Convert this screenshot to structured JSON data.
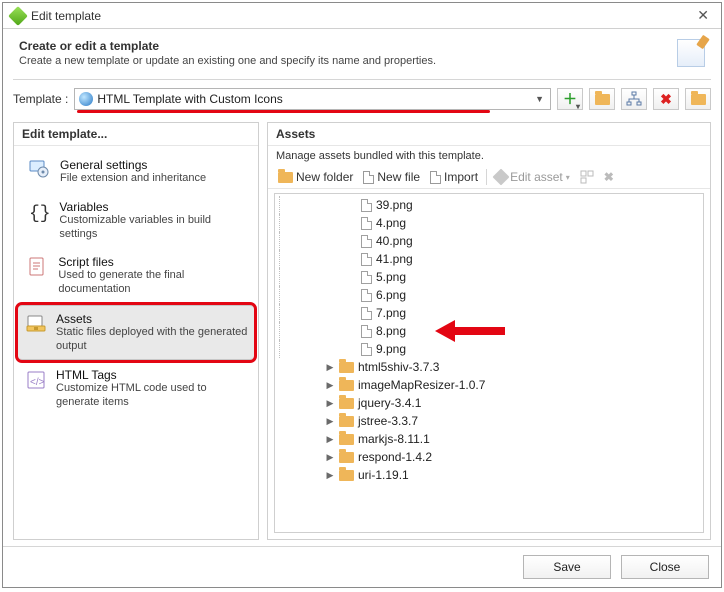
{
  "window": {
    "title": "Edit template",
    "close_tooltip": "Close"
  },
  "header": {
    "title": "Create or edit a template",
    "subtitle": "Create a new template or update an existing one and specify its name and properties."
  },
  "template_row": {
    "label": "Template :",
    "selected": "HTML Template with Custom Icons"
  },
  "left_panel": {
    "title": "Edit template...",
    "items": [
      {
        "title": "General settings",
        "desc": "File extension and inheritance"
      },
      {
        "title": "Variables",
        "desc": "Customizable variables in build settings"
      },
      {
        "title": "Script files",
        "desc": "Used to generate the final documentation"
      },
      {
        "title": "Assets",
        "desc": "Static files deployed with the generated output"
      },
      {
        "title": "HTML Tags",
        "desc": "Customize HTML code used to generate items"
      }
    ],
    "selected_index": 3
  },
  "right_panel": {
    "title": "Assets",
    "subtitle": "Manage assets bundled with this template.",
    "toolbar": {
      "new_folder": "New folder",
      "new_file": "New file",
      "import": "Import",
      "edit_asset": "Edit asset"
    },
    "files": [
      "39.png",
      "4.png",
      "40.png",
      "41.png",
      "5.png",
      "6.png",
      "7.png",
      "8.png",
      "9.png"
    ],
    "folders": [
      "html5shiv-3.7.3",
      "imageMapResizer-1.0.7",
      "jquery-3.4.1",
      "jstree-3.3.7",
      "markjs-8.11.1",
      "respond-1.4.2",
      "uri-1.19.1"
    ],
    "arrow_target_index": 7
  },
  "footer": {
    "save": "Save",
    "close": "Close"
  }
}
